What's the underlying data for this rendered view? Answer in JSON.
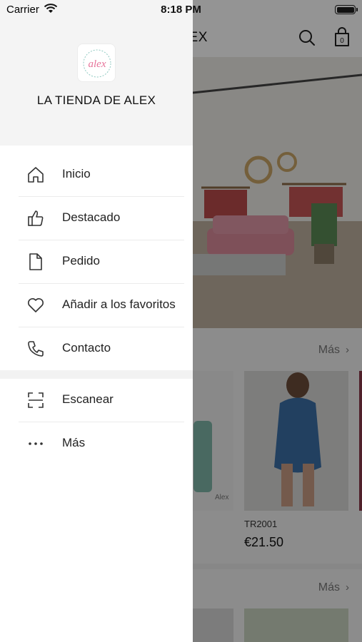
{
  "status_bar": {
    "carrier": "Carrier",
    "time": "8:18 PM"
  },
  "app": {
    "title": "LA TIENDA DE ALEX",
    "sections": [
      {
        "more_label": "Más"
      },
      {
        "more_label": "Más"
      }
    ],
    "products": [
      {
        "code": "TR2001",
        "price": "€21.50"
      }
    ],
    "hero_watermark": "Tienda de Alex"
  },
  "drawer": {
    "store_name": "LA TIENDA DE ALEX",
    "logo_text": "alex",
    "menu": [
      {
        "label": "Inicio",
        "icon": "home-icon"
      },
      {
        "label": "Destacado",
        "icon": "thumbs-up-icon"
      },
      {
        "label": "Pedido",
        "icon": "document-icon"
      },
      {
        "label": "Añadir a los favoritos",
        "icon": "heart-icon"
      },
      {
        "label": "Contacto",
        "icon": "phone-icon"
      }
    ],
    "secondary_menu": [
      {
        "label": "Escanear",
        "icon": "scan-icon"
      },
      {
        "label": "Más",
        "icon": "more-dots-icon"
      }
    ]
  },
  "colors": {
    "dim_overlay": "#000000",
    "drawer_header_bg": "#f4f4f4",
    "logo_pink": "#e7739a",
    "logo_teal": "#8fc9c1"
  }
}
